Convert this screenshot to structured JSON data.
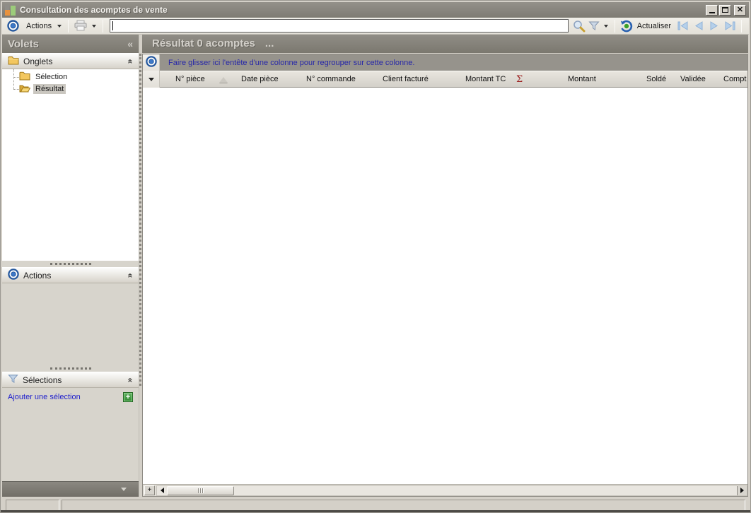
{
  "window": {
    "title": "Consultation des acomptes de vente"
  },
  "toolbar": {
    "actions_label": "Actions",
    "refresh_label": "Actualiser",
    "search": {
      "value": ""
    }
  },
  "sidebar": {
    "title": "Volets",
    "collapse_glyph": "«",
    "onglets": {
      "label": "Onglets",
      "items": [
        {
          "label": "Sélection",
          "selected": false
        },
        {
          "label": "Résultat",
          "selected": true
        }
      ]
    },
    "actions": {
      "label": "Actions"
    },
    "selections": {
      "label": "Sélections",
      "add_link": "Ajouter une sélection"
    }
  },
  "main": {
    "title": "Résultat 0 acomptes",
    "title_suffix": "...",
    "group_hint": "Faire glisser ici l'entête d'une colonne pour regrouper sur cette colonne.",
    "columns": [
      "N° pièce",
      "Date pièce",
      "N° commande",
      "Client facturé",
      "Montant TC",
      "Montant",
      "Soldé",
      "Validée",
      "Compt"
    ],
    "summary_sigma": "Σ",
    "rows": []
  },
  "colors": {
    "header_gray": "#83807a",
    "group_hint_blue": "#2828a8",
    "link_blue": "#2020cc",
    "sigma_red": "#9b1c1c",
    "accent_blue": "#2f62ad",
    "add_green": "#3f9b3f"
  }
}
